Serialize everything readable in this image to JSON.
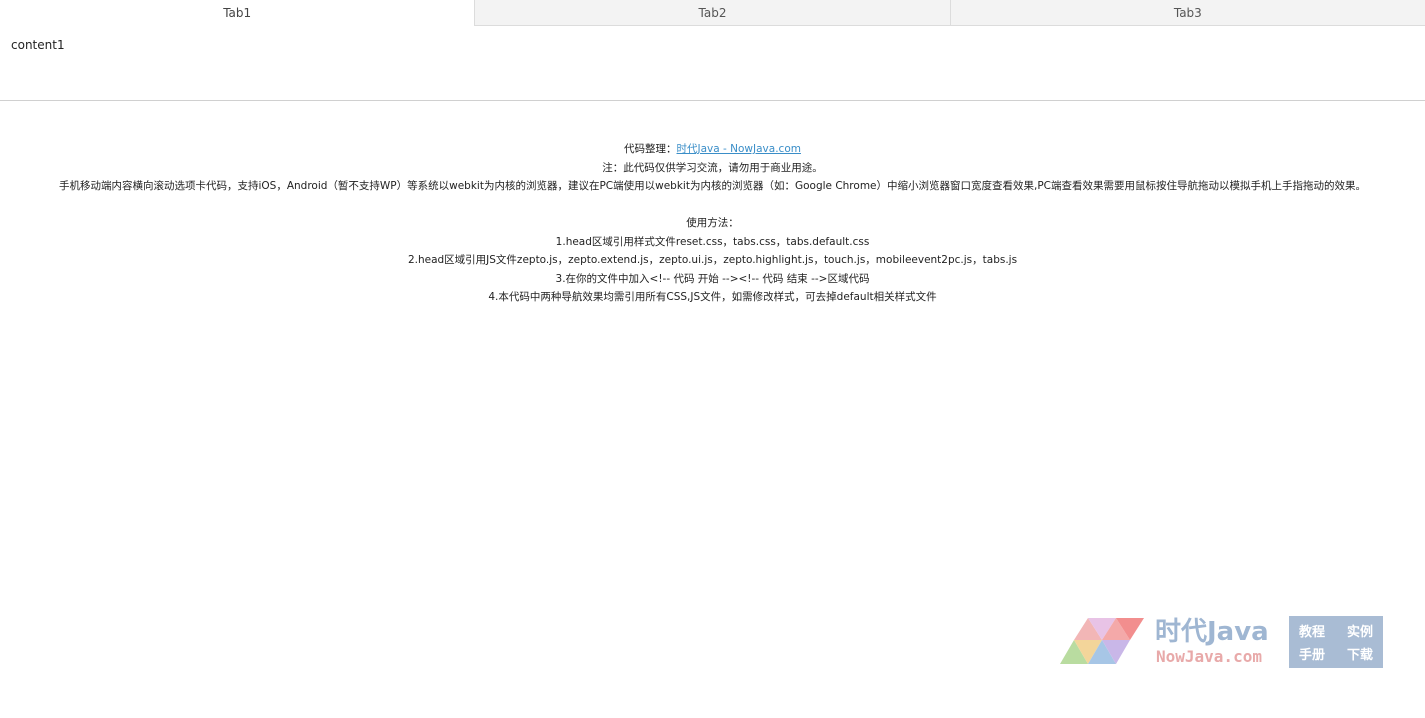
{
  "tabs": [
    {
      "label": "Tab1",
      "active": true
    },
    {
      "label": "Tab2",
      "active": false
    },
    {
      "label": "Tab3",
      "active": false
    }
  ],
  "panel": {
    "content": "content1"
  },
  "notes": {
    "organizer_prefix": "代码整理：",
    "organizer_link": "时代Java - NowJava.com",
    "disclaimer": "注：此代码仅供学习交流，请勿用于商业用途。",
    "description": "手机移动端内容横向滚动选项卡代码，支持iOS，Android（暂不支持WP）等系统以webkit为内核的浏览器，建议在PC端使用以webkit为内核的浏览器（如：Google Chrome）中缩小浏览器窗口宽度查看效果,PC端查看效果需要用鼠标按住导航拖动以模拟手机上手指拖动的效果。",
    "usage_title": "使用方法：",
    "steps": [
      "1.head区域引用样式文件reset.css，tabs.css，tabs.default.css",
      "2.head区域引用JS文件zepto.js，zepto.extend.js，zepto.ui.js，zepto.highlight.js，touch.js，mobileevent2pc.js，tabs.js",
      "3.在你的文件中加入<!-- 代码 开始 --><!-- 代码 结束 -->区域代码",
      "4.本代码中两种导航效果均需引用所有CSS,JS文件，如需修改样式，可去掉default相关样式文件"
    ]
  },
  "brand": {
    "title": "时代Java",
    "subtitle": "NowJava.com",
    "box": [
      "教程",
      "实例",
      "手册",
      "下载"
    ]
  },
  "colors": {
    "link": "#3a8ec8",
    "brand_blue": "#9fb6d2",
    "brand_red": "#e8a9a9",
    "brand_box": "#a9bcd4"
  }
}
